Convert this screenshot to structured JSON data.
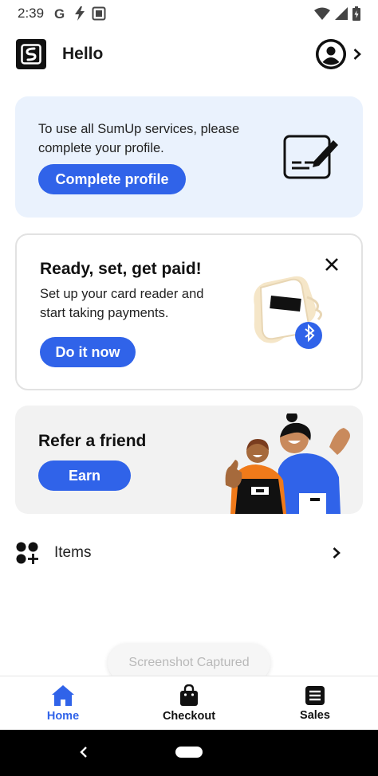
{
  "status_bar": {
    "time": "2:39",
    "icons": [
      "google-g-icon",
      "flash-icon",
      "screenshot-icon",
      "wifi-icon",
      "signal-icon",
      "battery-icon"
    ]
  },
  "header": {
    "title": "Hello",
    "logo_icon": "sumup-logo-icon",
    "profile_icon": "account-circle-icon"
  },
  "profile_card": {
    "text": "To use all SumUp services, please complete your profile.",
    "button_label": "Complete profile",
    "illustration": "edit-card-icon"
  },
  "paid_card": {
    "title": "Ready, set, get paid!",
    "text": "Set up your card reader and start taking payments.",
    "button_label": "Do it now",
    "close_icon": "close-icon",
    "illustration": "card-reader-bluetooth-illustration"
  },
  "refer_card": {
    "title": "Refer a friend",
    "button_label": "Earn",
    "illustration": "friends-waving-illustration"
  },
  "items_row": {
    "label": "Items",
    "icon": "add-items-icon"
  },
  "toast": {
    "text": "Screenshot Captured"
  },
  "bottom_nav": {
    "items": [
      {
        "label": "Home",
        "icon": "home-icon",
        "active": true
      },
      {
        "label": "Checkout",
        "icon": "shopping-bag-icon",
        "active": false
      },
      {
        "label": "Sales",
        "icon": "receipt-icon",
        "active": false
      }
    ]
  },
  "colors": {
    "accent": "#3063e9",
    "profile_card_bg": "#eaf2fd",
    "refer_card_bg": "#f2f2f2"
  }
}
